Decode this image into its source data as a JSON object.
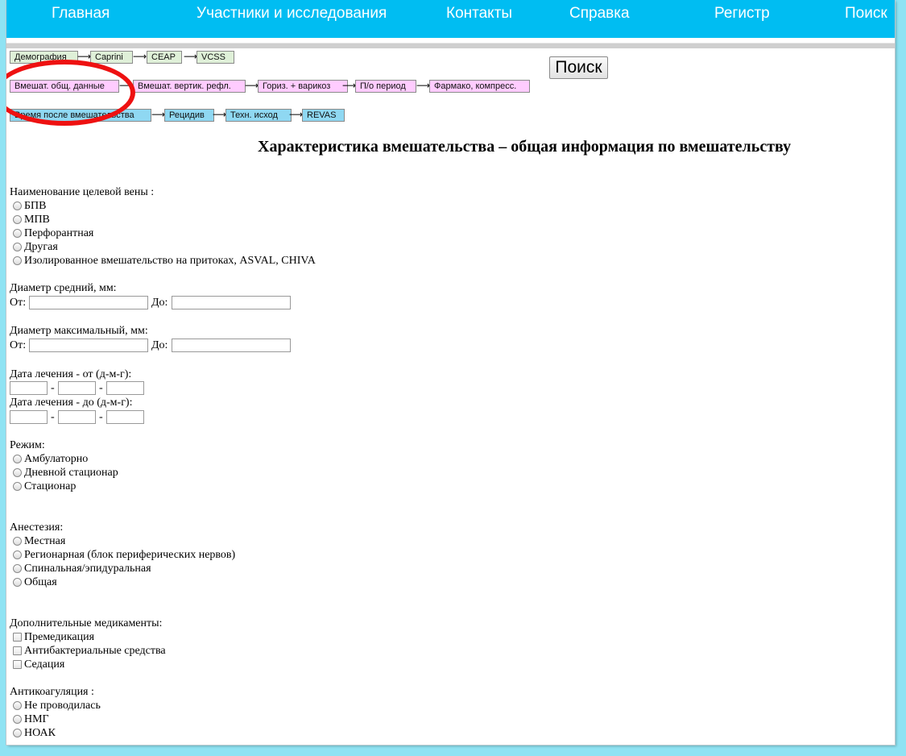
{
  "nav": {
    "items": [
      "Главная",
      "Участники и исследования",
      "Контакты",
      "Справка",
      "Регистр",
      "Поиск"
    ]
  },
  "steps": {
    "row1": [
      "Демография",
      "Caprini",
      "CEAP",
      "VCSS"
    ],
    "row2": [
      "Вмешат. общ. данные",
      "Вмешат. вертик. рефл.",
      "Гориз. + варикоз",
      "П/о период",
      "Фармако, компресс."
    ],
    "row3": [
      "Время после вмешательства",
      "Рецидив",
      "Техн. исход",
      "REVAS"
    ],
    "arrow": "⟶"
  },
  "search_button": "Поиск",
  "title": "Характеристика вмешательства – общая информация по вмешательству",
  "target_vein": {
    "label": "Наименование целевой вены :",
    "options": [
      "БПВ",
      "МПВ",
      "Перфорантная",
      "Другая",
      "Изолированное вмешательство на притоках, ASVAL, CHIVA"
    ]
  },
  "diameter_avg": {
    "label": "Диаметр средний, мм:",
    "from": "От:",
    "to": "До:"
  },
  "diameter_max": {
    "label": "Диаметр максимальный, мм:",
    "from": "От:",
    "to": "До:"
  },
  "treatment_date": {
    "from_label": "Дата лечения - от (д-м-г):",
    "to_label": "Дата лечения - до (д-м-г):",
    "separator": "-"
  },
  "mode": {
    "label": "Режим:",
    "options": [
      "Амбулаторно",
      "Дневной стационар",
      "Стационар"
    ]
  },
  "anesthesia": {
    "label": "Анестезия:",
    "options": [
      "Местная",
      "Регионарная (блок периферических нервов)",
      "Спинальная/эпидуральная",
      "Общая"
    ]
  },
  "extra_meds": {
    "label": "Дополнительные медикаменты:",
    "options": [
      "Премедикация",
      "Антибактериальные средства",
      "Седация"
    ]
  },
  "anticoagulation": {
    "label": "Антикоагуляция :",
    "options": [
      "Не проводилась",
      "НМГ",
      "НОАК"
    ]
  },
  "colors": {
    "nav_bg": "#00bdf2",
    "page_bg": "#8fe3f3",
    "step_green": "#dff0d8",
    "step_pink": "#ffccff",
    "step_blue": "#8fd8f2",
    "highlight_circle": "#ee1111"
  }
}
